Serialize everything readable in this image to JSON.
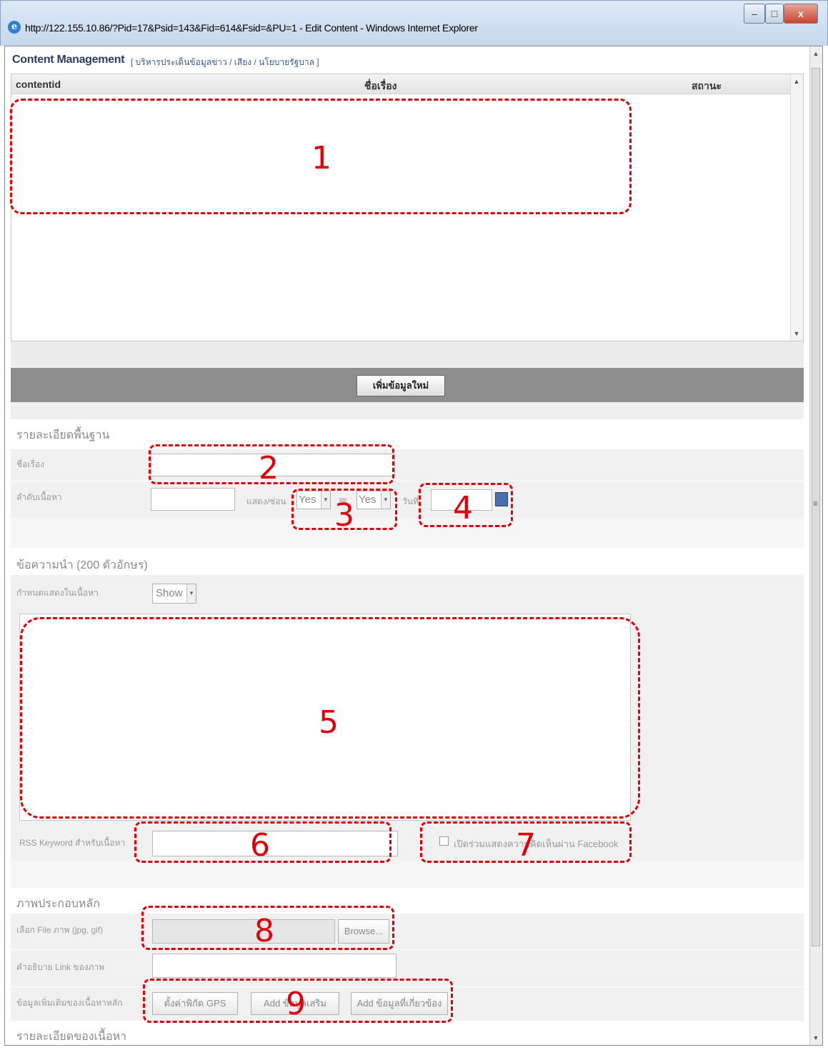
{
  "window": {
    "title": "http://122.155.10.86/?Pid=17&Psid=143&Fid=614&Fsid=&PU=1 - Edit Content - Windows Internet Explorer",
    "minimize_icon": "minimize-icon",
    "maximize_icon": "maximize-icon",
    "close_label": "x"
  },
  "page": {
    "title": "Content Management",
    "breadcrumb": "[ บริหารประเด็นข้อมูลข่าว / เสียง / นโยบายรัฐบาล ]"
  },
  "grid": {
    "columns": [
      "contentid",
      "ชื่อเรื่อง",
      "สถานะ"
    ],
    "rows": []
  },
  "toolbar": {
    "add_new_label": "เพิ่มข้อมูลใหม่"
  },
  "basic": {
    "section_title": "รายละเอียดพื้นฐาน",
    "subject_label": "ชื่อเรื่อง",
    "order_label": "ลำดับเนื้อหา",
    "display_label": "แสดง/ซ่อน",
    "display_value": "Yes",
    "second_select_value": "Yes",
    "date_label": "วันที่"
  },
  "intro": {
    "section_title": "ข้อความนำ (200 ตัวอักษร)",
    "show_label": "กำหนดแสดงในเนื้อหา",
    "show_value": "Show",
    "rss_label": "RSS Keyword สำหรับเนื้อหา",
    "facebook_label": "เปิดร่วมแสดงความคิดเห็นผ่าน Facebook"
  },
  "image": {
    "section_title": "ภาพประกอบหลัก",
    "file_label": "เลือก File ภาพ (jpg, gif)",
    "browse_label": "Browse...",
    "link_label": "คำอธิบาย Link ของภาพ",
    "extra_label": "ข้อมูลเพิ่มเติมของเนื้อหาหลัก",
    "gps_button": "ตั้งค่าพิกัด GPS",
    "add_button": "Add ข้อมูลเสริม",
    "add_related_button": "Add ข้อมูลที่เกี่ยวข้อง"
  },
  "detail": {
    "section_title": "รายละเอียดของเนื้อหา"
  },
  "annotations": [
    "1",
    "2",
    "3",
    "4",
    "5",
    "6",
    "7",
    "8",
    "9"
  ],
  "colors": {
    "annotation": "#e0000a",
    "header_bar": "#8e8e8e"
  }
}
